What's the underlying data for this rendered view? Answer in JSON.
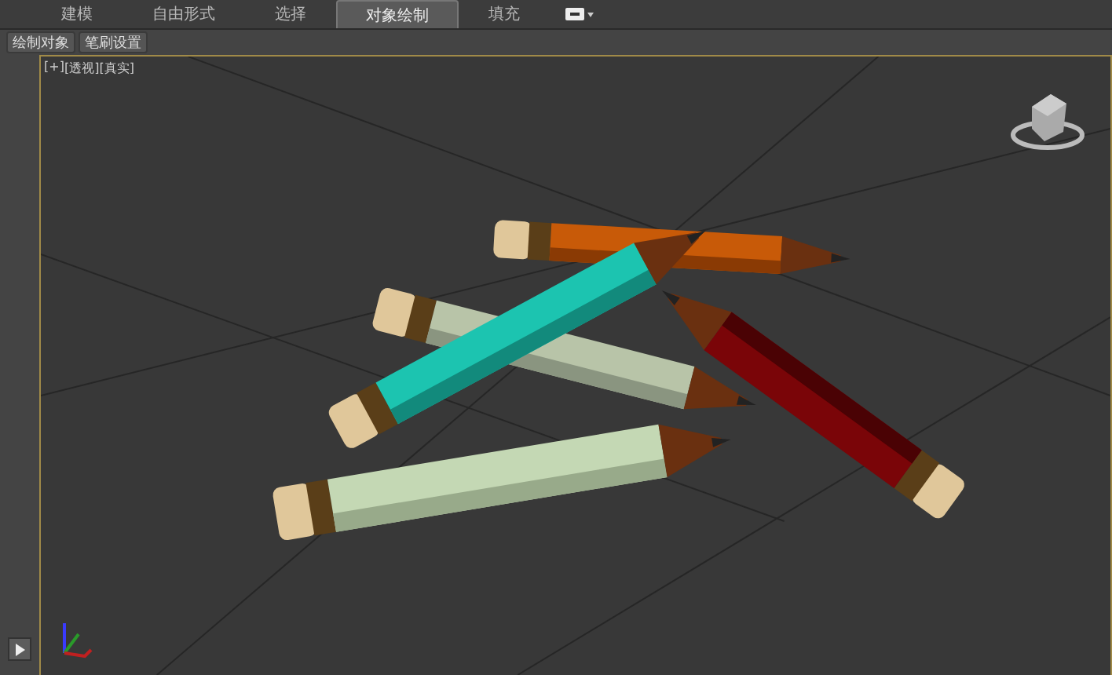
{
  "tabs": [
    {
      "label": "建模",
      "selected": false
    },
    {
      "label": "自由形式",
      "selected": false
    },
    {
      "label": "选择",
      "selected": false
    },
    {
      "label": "对象绘制",
      "selected": true
    },
    {
      "label": "填充",
      "selected": false
    }
  ],
  "panel_buttons": [
    "绘制对象",
    "笔刷设置"
  ],
  "viewport": {
    "labels": [
      "[+]",
      "[透视]",
      "[真实]"
    ]
  }
}
